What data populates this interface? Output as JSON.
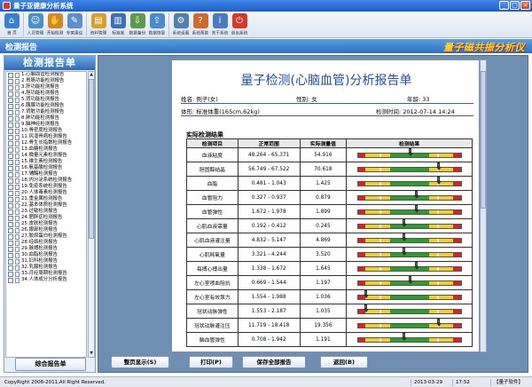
{
  "window": {
    "title": "量子亚健康分析系统",
    "controls": {
      "minimize": "_",
      "maximize": "□",
      "close": "×"
    }
  },
  "toolbar": {
    "items": [
      {
        "label": "首 页",
        "icon": "home-icon",
        "color": "#3b7fd4"
      },
      {
        "label": "人员管理",
        "icon": "users-icon",
        "color": "#4a90c8"
      },
      {
        "label": "开始检测",
        "icon": "hand-icon",
        "color": "#d08a2a"
      },
      {
        "label": "专家建议",
        "icon": "expert-icon",
        "color": "#5b8fd0"
      },
      {
        "label": "资料管理",
        "icon": "folder-icon",
        "color": "#d8a028"
      },
      {
        "label": "标准库",
        "icon": "book-icon",
        "color": "#3c6fb8"
      },
      {
        "label": "数据备份",
        "icon": "backup-icon",
        "color": "#5a9a48"
      },
      {
        "label": "数据恢复",
        "icon": "restore-icon",
        "color": "#4a8ad0"
      },
      {
        "label": "系统设置",
        "icon": "settings-icon",
        "color": "#4f7fb0"
      },
      {
        "label": "系统帮助",
        "icon": "help-icon",
        "color": "#d06a2a"
      },
      {
        "label": "关于系统",
        "icon": "about-icon",
        "color": "#4a7ac0"
      },
      {
        "label": "退出系统",
        "icon": "exit-icon",
        "color": "#d23a2a"
      }
    ]
  },
  "band": {
    "section_title": "检测报告",
    "banner": "量子磁共振分析仪"
  },
  "sidebar": {
    "header": "检测报告单",
    "items": [
      "1.心脑血管检测报告",
      "2.胃肠功能检测报告",
      "3.肝功能检测报告",
      "4.胆功能检测报告",
      "5.肾功能检测报告",
      "6.胰腺功能检测报告",
      "7.肾脏功能检测报告",
      "8.肺功能检测报告",
      "9.脑神经检测报告",
      "10.骨密度检测报告",
      "11.风湿骨病检测报告",
      "12.骨生长指数检测报告",
      "13.血糖检测报告",
      "14.微量元素检测报告",
      "15.维生素检测报告",
      "16.氨基酸检测报告",
      "17.辅酶检测报告",
      "18.内分泌系统检测报告",
      "19.免疫系统检测报告",
      "20.人体毒素检测报告",
      "21.重金属检测报告",
      "22.基本体质检测报告",
      "23.过敏检测报告",
      "24.肥胖症检测报告",
      "25.皮肤检测报告",
      "26.眼部检测报告",
      "27.胶原蛋白检测报告",
      "28.经络检测报告",
      "29.脉搏检测报告",
      "30.血脂检测报告",
      "31.妇科检测报告",
      "32.乳腺检测报告",
      "33.月经周期检测报告",
      "34.人体成分分析报告"
    ],
    "summary_button": "综合报告单",
    "scroll_up": "▲",
    "scroll_down": "▼"
  },
  "report": {
    "title": "量子检测(心脑血管)分析报告单",
    "name": "姓名: 例子(女)",
    "gender": "性别: 女",
    "age": "年龄: 33",
    "weight": "体形: 标准体重(165cm,62kg)",
    "time": "检测时间: 2012-07-14 14:24",
    "results_heading": "实际检测结果",
    "columns": [
      "检测项目",
      "正常范围",
      "实际测量值",
      "检测结果"
    ],
    "rows": [
      {
        "item": "血液粘度",
        "range": "48.264 - 65.371",
        "value": "54.916",
        "level": 0.5
      },
      {
        "item": "胆固醇结晶",
        "range": "56.749 - 67.522",
        "value": "70.618",
        "level": 0.78
      },
      {
        "item": "血脂",
        "range": "0.481 - 1.043",
        "value": "1.425",
        "level": 0.78
      },
      {
        "item": "血管阻力",
        "range": "0.327 - 0.937",
        "value": "0.879",
        "level": 0.56
      },
      {
        "item": "血管弹性",
        "range": "1.672 - 1.978",
        "value": "1.899",
        "level": 0.56
      },
      {
        "item": "心肌血液需量",
        "range": "0.192 - 0.412",
        "value": "0.245",
        "level": 0.44
      },
      {
        "item": "心肌血液灌注量",
        "range": "4.832 - 5.147",
        "value": "4.869",
        "level": 0.44
      },
      {
        "item": "心肌耗氧量",
        "range": "3.321 - 4.244",
        "value": "3.520",
        "level": 0.44
      },
      {
        "item": "每搏心搏出量",
        "range": "1.338 - 1.672",
        "value": "1.645",
        "level": 0.56
      },
      {
        "item": "左心室喷血阻抗",
        "range": "0.669 - 1.544",
        "value": "1.197",
        "level": 0.5
      },
      {
        "item": "左心室有效泵力",
        "range": "1.554 - 1.988",
        "value": "1.036",
        "level": 0.07
      },
      {
        "item": "冠状动脉弹性",
        "range": "1.553 - 2.187",
        "value": "1.035",
        "level": 0.07
      },
      {
        "item": "冠状动脉灌注压",
        "range": "11.719 - 18.418",
        "value": "19.356",
        "level": 0.78
      },
      {
        "item": "脑血管弹性",
        "range": "0.708 - 1.942",
        "value": "1.191",
        "level": 0.44
      }
    ]
  },
  "buttons": {
    "fit_page": "整页显示(S)",
    "print": "打印(P)",
    "save_all": "保存全部报告",
    "back": "返回(B)"
  },
  "status": {
    "copyright": "CopyRight 2008-2011,All Right Reserved.",
    "date": "2013-03-29",
    "time": "17:52",
    "brand": "【量子软件】"
  }
}
